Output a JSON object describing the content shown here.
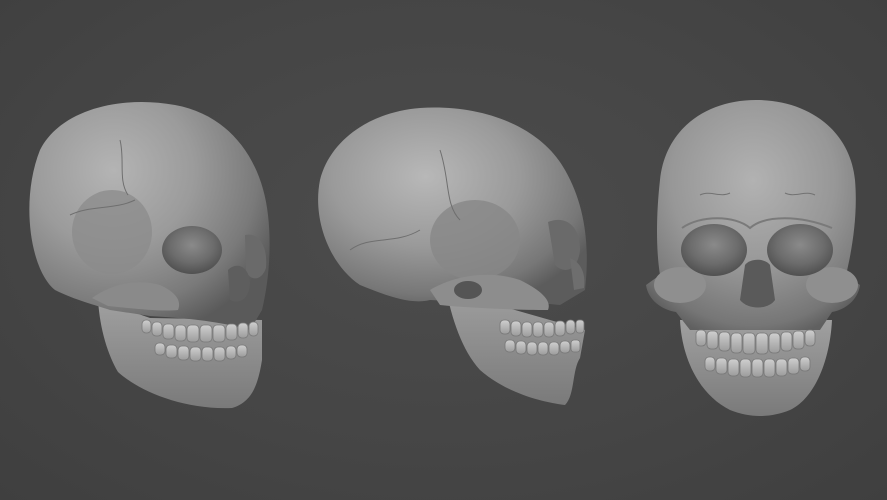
{
  "scene": {
    "description_free": true,
    "background_color": "#474747",
    "surface_color": "#9a9a9a",
    "views": [
      {
        "id": "three-quarter",
        "label": ""
      },
      {
        "id": "side",
        "label": ""
      },
      {
        "id": "front",
        "label": ""
      }
    ]
  }
}
